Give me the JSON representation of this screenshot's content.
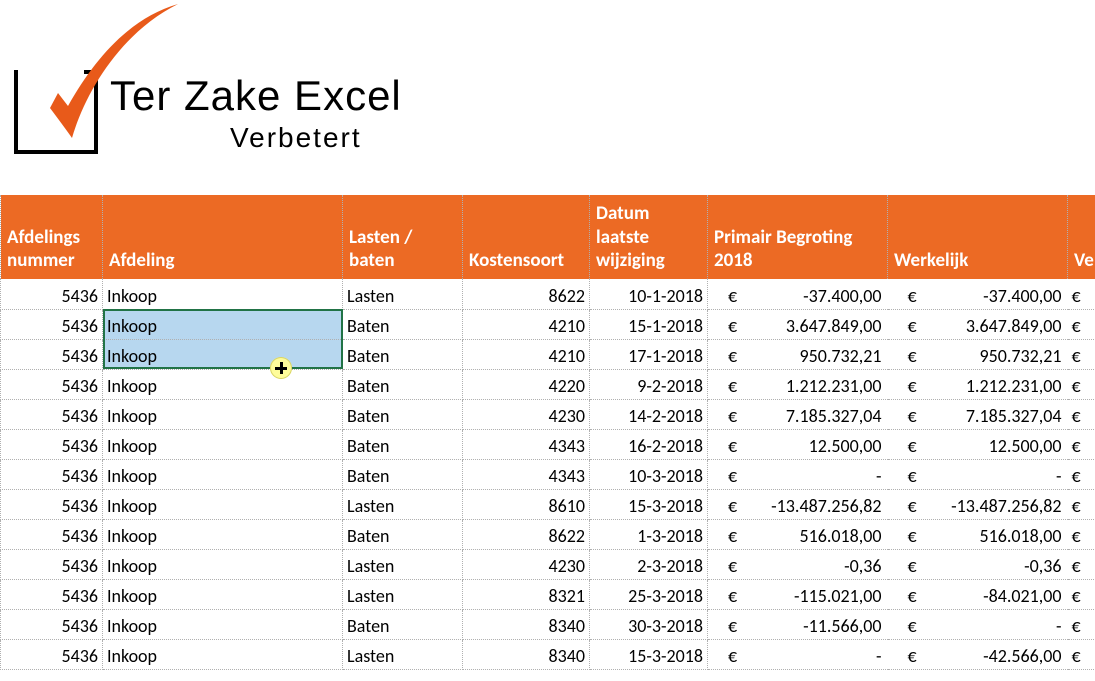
{
  "logo": {
    "title": "Ter Zake Excel",
    "subtitle": "Verbetert"
  },
  "headers": {
    "col0": "Afdelings nummer",
    "col1": "Afdeling",
    "col2": "Lasten / baten",
    "col3": "Kostensoort",
    "col4": "Datum laatste wijziging",
    "col5": "Primair Begroting 2018",
    "col6": "Werkelijk",
    "col7": "Ve"
  },
  "currency_symbol": "€",
  "rows": [
    {
      "afdnum": "5436",
      "afdeling": "Inkoop",
      "lb": "Lasten",
      "kost": "8622",
      "datum": "10-1-2018",
      "primair": "-37.400,00",
      "werkelijk": "-37.400,00",
      "selected": false
    },
    {
      "afdnum": "5436",
      "afdeling": "Inkoop",
      "lb": "Baten",
      "kost": "4210",
      "datum": "15-1-2018",
      "primair": "3.647.849,00",
      "werkelijk": "3.647.849,00",
      "selected": true
    },
    {
      "afdnum": "5436",
      "afdeling": "Inkoop",
      "lb": "Baten",
      "kost": "4210",
      "datum": "17-1-2018",
      "primair": "950.732,21",
      "werkelijk": "950.732,21",
      "selected": true
    },
    {
      "afdnum": "5436",
      "afdeling": "Inkoop",
      "lb": "Baten",
      "kost": "4220",
      "datum": "9-2-2018",
      "primair": "1.212.231,00",
      "werkelijk": "1.212.231,00",
      "selected": false
    },
    {
      "afdnum": "5436",
      "afdeling": "Inkoop",
      "lb": "Baten",
      "kost": "4230",
      "datum": "14-2-2018",
      "primair": "7.185.327,04",
      "werkelijk": "7.185.327,04",
      "selected": false
    },
    {
      "afdnum": "5436",
      "afdeling": "Inkoop",
      "lb": "Baten",
      "kost": "4343",
      "datum": "16-2-2018",
      "primair": "12.500,00",
      "werkelijk": "12.500,00",
      "selected": false
    },
    {
      "afdnum": "5436",
      "afdeling": "Inkoop",
      "lb": "Baten",
      "kost": "4343",
      "datum": "10-3-2018",
      "primair": "-",
      "werkelijk": "-",
      "selected": false
    },
    {
      "afdnum": "5436",
      "afdeling": "Inkoop",
      "lb": "Lasten",
      "kost": "8610",
      "datum": "15-3-2018",
      "primair": "-13.487.256,82",
      "werkelijk": "-13.487.256,82",
      "selected": false
    },
    {
      "afdnum": "5436",
      "afdeling": "Inkoop",
      "lb": "Baten",
      "kost": "8622",
      "datum": "1-3-2018",
      "primair": "516.018,00",
      "werkelijk": "516.018,00",
      "selected": false
    },
    {
      "afdnum": "5436",
      "afdeling": "Inkoop",
      "lb": "Lasten",
      "kost": "4230",
      "datum": "2-3-2018",
      "primair": "-0,36",
      "werkelijk": "-0,36",
      "selected": false
    },
    {
      "afdnum": "5436",
      "afdeling": "Inkoop",
      "lb": "Lasten",
      "kost": "8321",
      "datum": "25-3-2018",
      "primair": "-115.021,00",
      "werkelijk": "-84.021,00",
      "selected": false
    },
    {
      "afdnum": "5436",
      "afdeling": "Inkoop",
      "lb": "Baten",
      "kost": "8340",
      "datum": "30-3-2018",
      "primair": "-11.566,00",
      "werkelijk": "-",
      "selected": false
    },
    {
      "afdnum": "5436",
      "afdeling": "Inkoop",
      "lb": "Lasten",
      "kost": "8340",
      "datum": "15-3-2018",
      "primair": "-",
      "werkelijk": "-42.566,00",
      "selected": false
    }
  ]
}
